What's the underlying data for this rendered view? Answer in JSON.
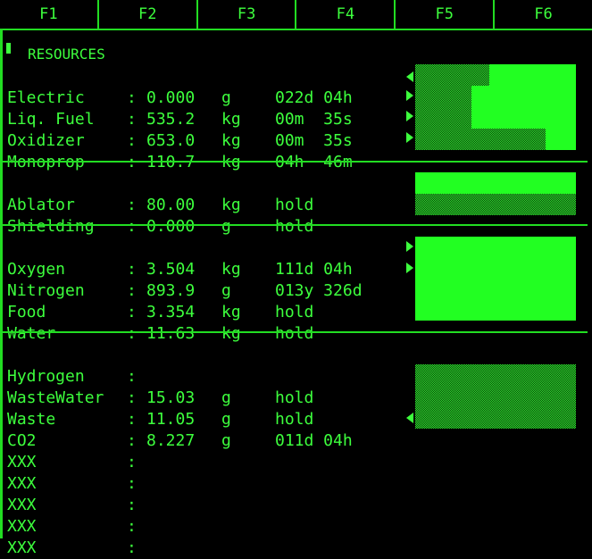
{
  "function_keys": [
    "F1",
    "F2",
    "F3",
    "F4",
    "F5",
    "F6"
  ],
  "section_title": "RESOURCES",
  "groups": [
    {
      "rows": [
        {
          "name": "Electric",
          "colon": ":",
          "value": "0.000",
          "unit": "g",
          "time": "022d 04h"
        },
        {
          "name": "Liq. Fuel",
          "colon": ":",
          "value": "535.2",
          "unit": "kg",
          "time": "00m  35s"
        },
        {
          "name": "Oxidizer",
          "colon": ":",
          "value": "653.0",
          "unit": "kg",
          "time": "00m  35s"
        },
        {
          "name": "Monoprop",
          "colon": ":",
          "value": "110.7",
          "unit": "kg",
          "time": "04h  46m"
        }
      ]
    },
    {
      "rows": [
        {
          "name": "Ablator",
          "colon": ":",
          "value": "80.00",
          "unit": "kg",
          "time": "hold"
        },
        {
          "name": "Shielding",
          "colon": ":",
          "value": "0.000",
          "unit": "g",
          "time": "hold"
        }
      ]
    },
    {
      "rows": [
        {
          "name": "Oxygen",
          "colon": ":",
          "value": "3.504",
          "unit": "kg",
          "time": "111d 04h"
        },
        {
          "name": "Nitrogen",
          "colon": ":",
          "value": "893.9",
          "unit": "g",
          "time": "013y 326d"
        },
        {
          "name": "Food",
          "colon": ":",
          "value": "3.354",
          "unit": "kg",
          "time": "hold"
        },
        {
          "name": "Water",
          "colon": ":",
          "value": "11.63",
          "unit": "kg",
          "time": "hold"
        }
      ]
    },
    {
      "rows": [
        {
          "name": "Hydrogen",
          "colon": ":",
          "value": "",
          "unit": "",
          "time": ""
        },
        {
          "name": "WasteWater",
          "colon": ":",
          "value": "15.03",
          "unit": "g",
          "time": "hold"
        },
        {
          "name": "Waste",
          "colon": ":",
          "value": "11.05",
          "unit": "g",
          "time": "hold"
        },
        {
          "name": "CO2",
          "colon": ":",
          "value": "8.227",
          "unit": "g",
          "time": "011d 04h"
        },
        {
          "name": "XXX",
          "colon": ":",
          "value": "",
          "unit": "",
          "time": ""
        },
        {
          "name": "XXX",
          "colon": ":",
          "value": "",
          "unit": "",
          "time": ""
        },
        {
          "name": "XXX",
          "colon": ":",
          "value": "",
          "unit": "",
          "time": ""
        },
        {
          "name": "XXX",
          "colon": ":",
          "value": "",
          "unit": "",
          "time": ""
        },
        {
          "name": "XXX",
          "colon": ":",
          "value": "",
          "unit": "",
          "time": ""
        }
      ]
    }
  ],
  "gauges": {
    "electric_fill": 0.54,
    "liq_fuel_fill": 0.65,
    "oxidizer_fill": 0.65,
    "monoprop_fill": 0.19,
    "ablator_fill": 1.0,
    "shielding_fill": 0.0,
    "life_support_fill": 1.0,
    "waste_fill": 0.0
  },
  "arrows": {
    "electric": "left",
    "liq_fuel": "right",
    "oxidizer": "right",
    "monoprop": "right",
    "oxygen": "right",
    "nitrogen": "right",
    "co2": "left"
  },
  "colors": {
    "text": "#3dff3d",
    "line": "#22dd22",
    "fill": "#22ff22",
    "dither": "#2ee82e",
    "background": "#000000"
  }
}
